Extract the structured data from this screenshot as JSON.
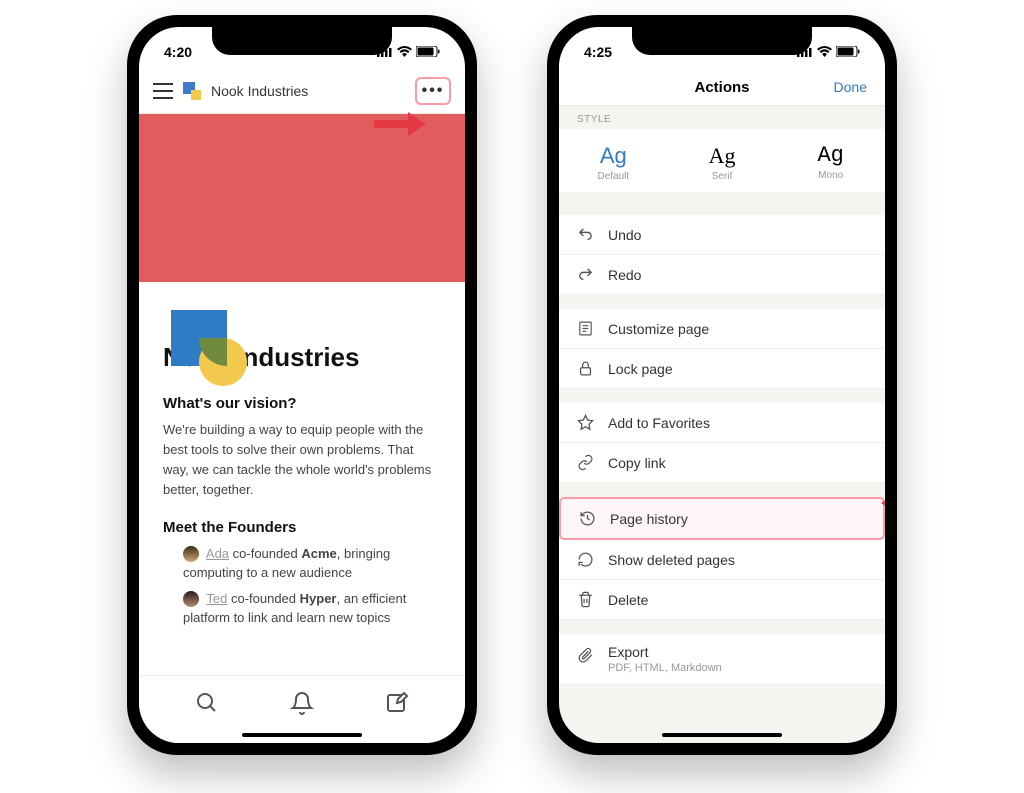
{
  "phone1": {
    "time": "4:20",
    "nav_title": "Nook Industries",
    "page_title": "Nook Industries",
    "vision_heading": "What's our vision?",
    "vision_body": "We're building a way to equip people with the best tools to solve their own problems. That way, we can tackle the whole world's problems better, together.",
    "founders_heading": "Meet the Founders",
    "founder1_name": "Ada",
    "founder1_text_a": " co-founded ",
    "founder1_company": "Acme",
    "founder1_text_b": ", bringing computing to a new audience",
    "founder2_name": "Ted",
    "founder2_text_a": " co-founded ",
    "founder2_company": "Hyper",
    "founder2_text_b": ", an efficient platform to link and learn new topics"
  },
  "phone2": {
    "time": "4:25",
    "header_title": "Actions",
    "done": "Done",
    "style_label": "STYLE",
    "styles": {
      "default": "Default",
      "serif": "Serif",
      "mono": "Mono",
      "ag": "Ag"
    },
    "items": {
      "undo": "Undo",
      "redo": "Redo",
      "customize": "Customize page",
      "lock": "Lock page",
      "favorites": "Add to Favorites",
      "copylink": "Copy link",
      "history": "Page history",
      "showdeleted": "Show deleted pages",
      "delete": "Delete",
      "export": "Export",
      "export_sub": "PDF, HTML, Markdown"
    }
  }
}
